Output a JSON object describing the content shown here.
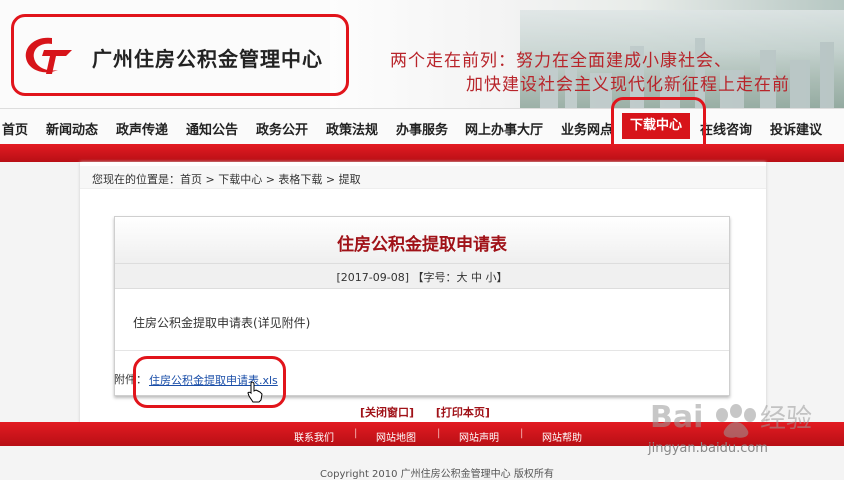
{
  "header": {
    "site_title": "广州住房公积金管理中心",
    "slogan_line1": "两个走在前列：努力在全面建成小康社会、",
    "slogan_line2": "加快建设社会主义现代化新征程上走在前"
  },
  "nav": {
    "items": [
      "首页",
      "新闻动态",
      "政声传递",
      "通知公告",
      "政务公开",
      "政策法规",
      "办事服务",
      "网上办事大厅",
      "业务网点",
      "下载中心",
      "在线咨询",
      "投诉建议"
    ],
    "active_index": 9
  },
  "breadcrumb": "您现在的位置是：首页 > 下载中心 > 表格下载 > 提取",
  "article": {
    "title": "住房公积金提取申请表",
    "meta": "[2017-09-08] 【字号：大 中 小】",
    "body": "住房公积金提取申请表(详见附件)",
    "attachment_label": "附件：",
    "attachment_link": "住房公积金提取申请表.xls"
  },
  "actions": {
    "close": "[关闭窗口]",
    "print": "[打印本页]"
  },
  "footer": {
    "links": [
      "联系我们",
      "网站地图",
      "网站声明",
      "网站帮助"
    ],
    "copyright": "Copyright 2010 广州住房公积金管理中心 版权所有"
  },
  "watermark": {
    "brand": "Baidu 经验",
    "url": "jingyan.baidu.com"
  },
  "colors": {
    "brand_red": "#d7141a",
    "title_red": "#a01218",
    "link_blue": "#1a4ea8",
    "highlight_red": "#e1141b"
  },
  "icons": [
    "logo-icon",
    "mouse-pointer-icon"
  ]
}
